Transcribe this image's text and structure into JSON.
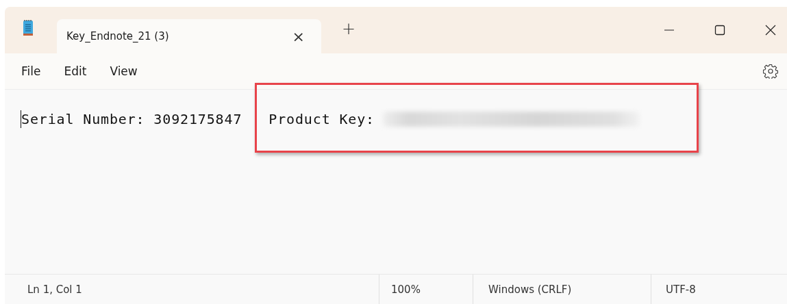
{
  "window": {
    "tab": {
      "title": "Key_Endnote_21 (3)",
      "selected": true,
      "close": "×"
    },
    "new_tab": "+"
  },
  "menu": [
    "File",
    "Edit",
    "View"
  ],
  "document": {
    "segments": [
      {
        "kind": "text",
        "text": "Serial Number: 3092175847"
      },
      {
        "kind": "text",
        "text": "Product Key:"
      },
      {
        "kind": "redacted"
      }
    ],
    "cursor": true
  },
  "annotation": {
    "kind": "highlight-box",
    "color": "#e8434a"
  },
  "status_bar": [
    {
      "text": "Ln 1, Col 1"
    },
    {
      "text": "100%"
    },
    {
      "text": "Windows (CRLF)"
    },
    {
      "text": "UTF-8"
    }
  ]
}
